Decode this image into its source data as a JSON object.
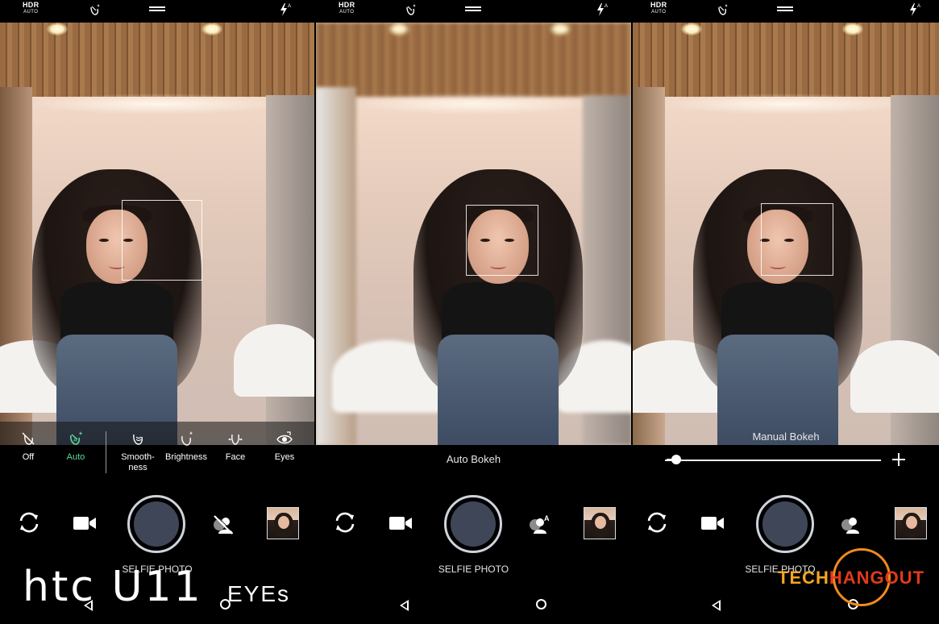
{
  "status_bar": {
    "hdr_label": "HDR",
    "hdr_mode": "AUTO",
    "icons": [
      "beauty-mode-icon",
      "menu-icon",
      "flash-auto-icon"
    ],
    "flash_badge": "A"
  },
  "panel1": {
    "beauty_options": [
      {
        "label": "Off",
        "icon": "beauty-off-icon",
        "active": false
      },
      {
        "label": "Auto",
        "icon": "beauty-auto-icon",
        "active": true
      },
      {
        "label": "Smooth-\nness",
        "icon": "smoothness-icon",
        "active": false
      },
      {
        "label": "Brightness",
        "icon": "brightness-icon",
        "active": false
      },
      {
        "label": "Face",
        "icon": "face-icon",
        "active": false
      },
      {
        "label": "Eyes",
        "icon": "eyes-icon",
        "active": false
      }
    ],
    "active_color": "#5dd89a"
  },
  "panel2": {
    "mode_label": "Auto Bokeh"
  },
  "panel3": {
    "mode_label": "Manual Bokeh",
    "slider_value": 0.03
  },
  "controls": {
    "camera_mode_label": "SELFIE PHOTO",
    "bokeh_badge": "A"
  },
  "watermarks": {
    "htc": "htc U11",
    "htc_suffix": "EYEs",
    "techhangout_part1": "TECH",
    "techhangout_part2": "HANGOUT",
    "colors": {
      "tech": "#f5a623",
      "hangout": "#e23b1b",
      "ring": "#f18a1c"
    }
  }
}
